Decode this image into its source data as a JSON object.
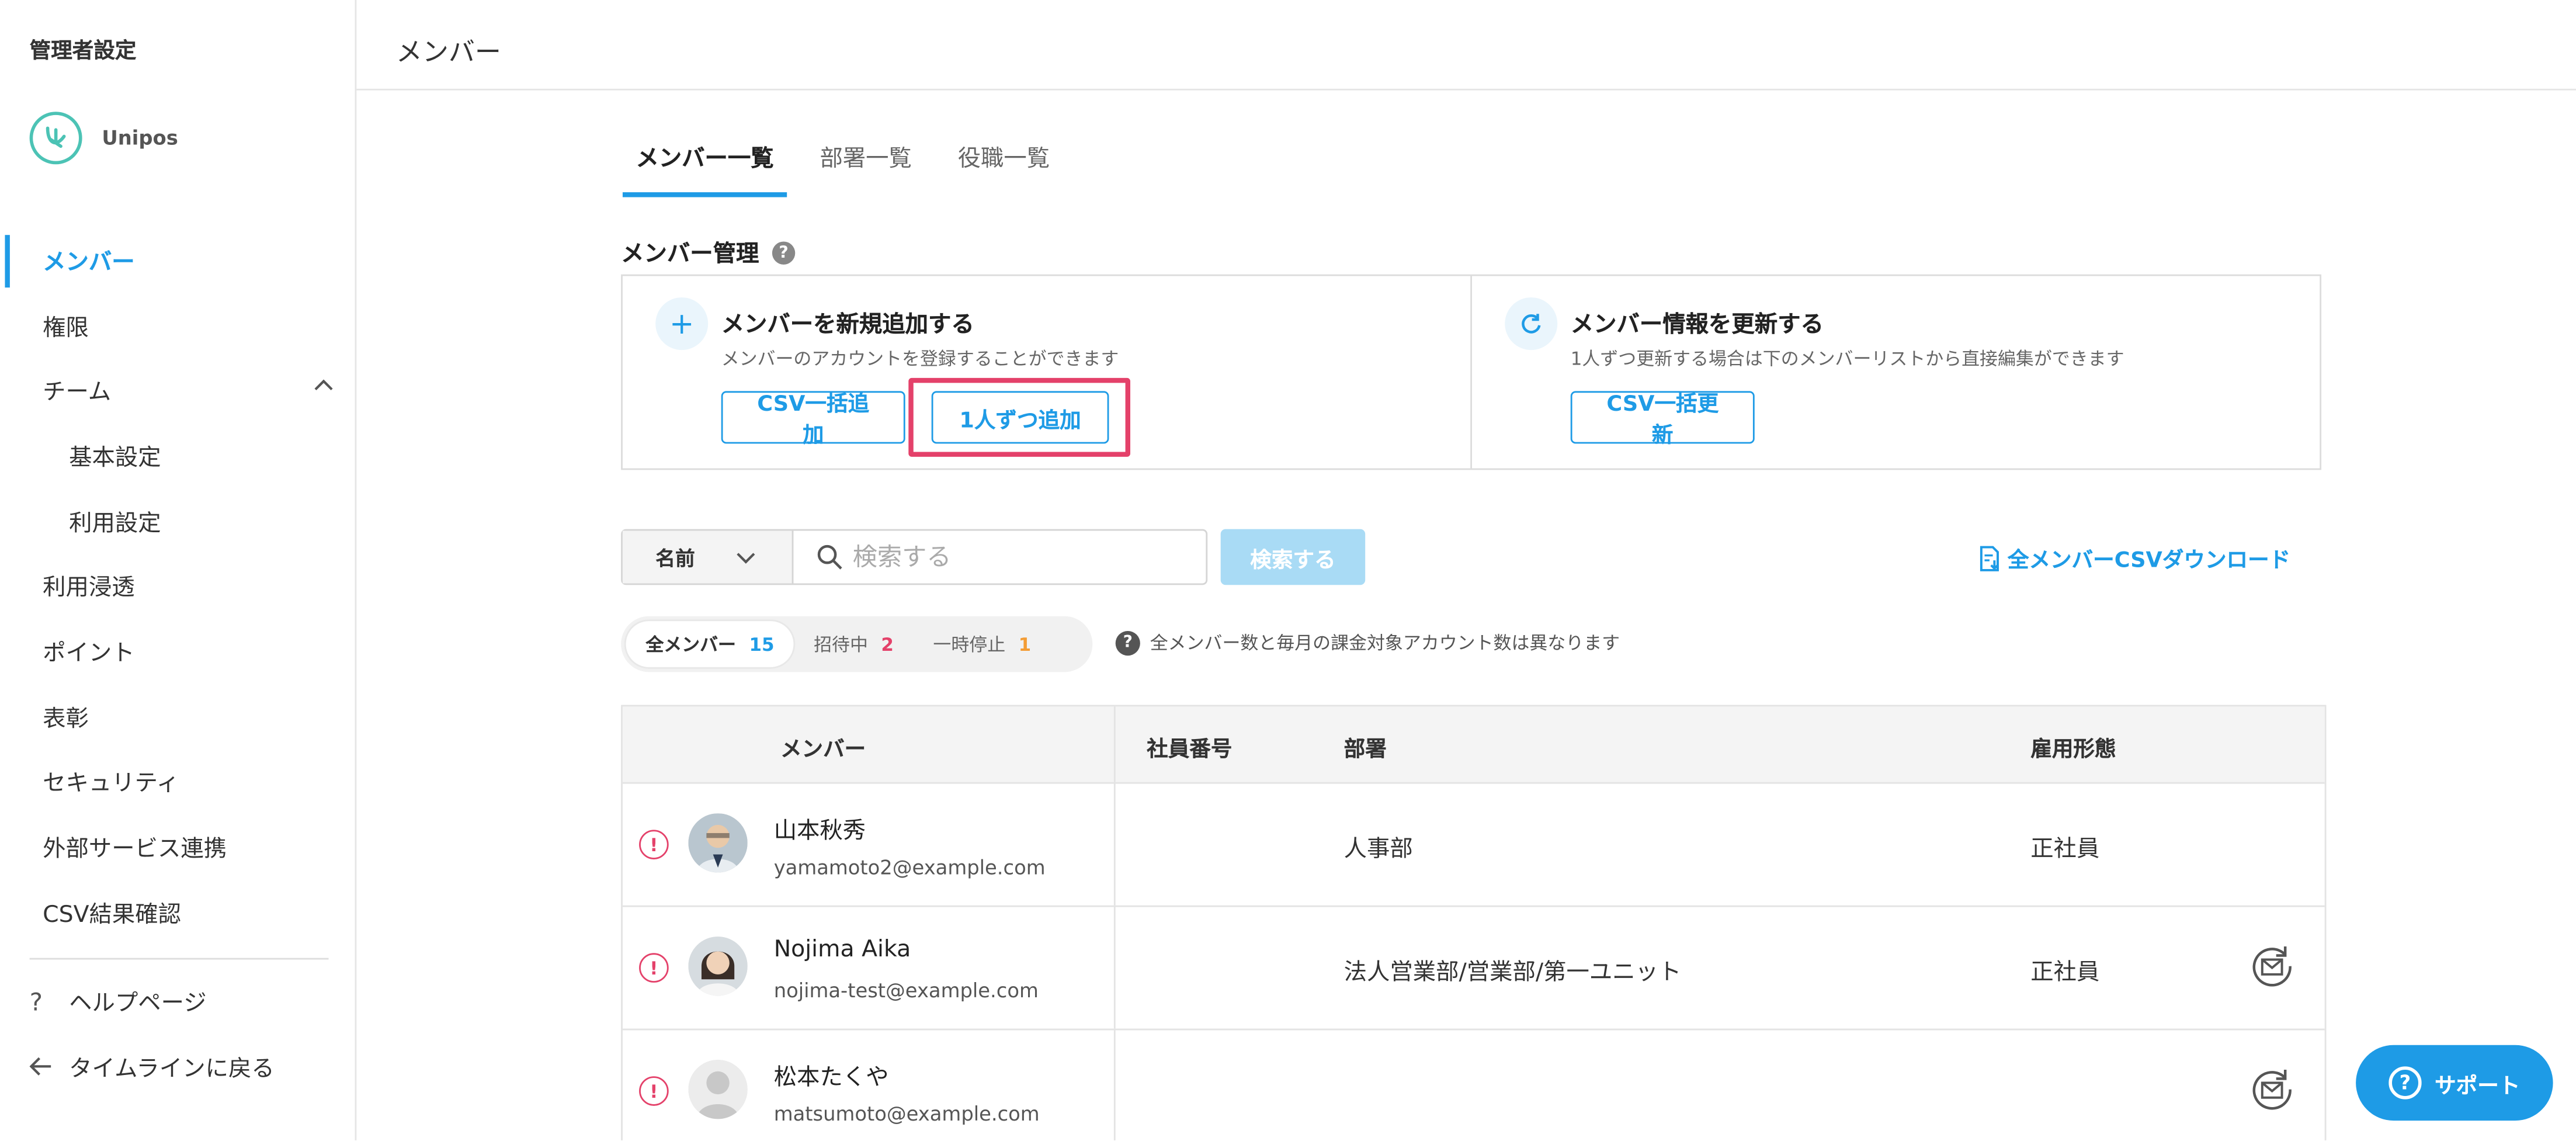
{
  "sidebar": {
    "title": "管理者設定",
    "org_name": "Unipos",
    "items": [
      {
        "label": "メンバー"
      },
      {
        "label": "権限"
      },
      {
        "label": "チーム"
      },
      {
        "label": "基本設定"
      },
      {
        "label": "利用設定"
      },
      {
        "label": "利用浸透"
      },
      {
        "label": "ポイント"
      },
      {
        "label": "表彰"
      },
      {
        "label": "セキュリティ"
      },
      {
        "label": "外部サービス連携"
      },
      {
        "label": "CSV結果確認"
      }
    ],
    "help_label": "ヘルプページ",
    "back_label": "タイムラインに戻る"
  },
  "header": {
    "title": "メンバー"
  },
  "tabs": [
    {
      "label": "メンバー一覧"
    },
    {
      "label": "部署一覧"
    },
    {
      "label": "役職一覧"
    }
  ],
  "member_mgmt": {
    "title": "メンバー管理",
    "add": {
      "title": "メンバーを新規追加する",
      "desc": "メンバーのアカウントを登録することができます",
      "csv_button": "CSV一括追加",
      "single_button": "1人ずつ追加"
    },
    "update": {
      "title": "メンバー情報を更新する",
      "desc": "1人ずつ更新する場合は下のメンバーリストから直接編集ができます",
      "csv_button": "CSV一括更新"
    }
  },
  "search": {
    "field_select": "名前",
    "placeholder": "検索する",
    "button": "検索する",
    "csv_download": "全メンバーCSVダウンロード"
  },
  "filters": {
    "pills": [
      {
        "label": "全メンバー",
        "count": "15",
        "color": "#1e9be6"
      },
      {
        "label": "招待中",
        "count": "2",
        "color": "#e4416a"
      },
      {
        "label": "一時停止",
        "count": "1",
        "color": "#f39c34"
      }
    ],
    "note": "全メンバー数と毎月の課金対象アカウント数は異なります"
  },
  "table": {
    "headers": {
      "member": "メンバー",
      "emp_no": "社員番号",
      "dept": "部署",
      "emp_type": "雇用形態"
    },
    "rows": [
      {
        "name": "山本秋秀",
        "email": "yamamoto2@example.com",
        "emp_no": "",
        "dept": "人事部",
        "emp_type": "正社員"
      },
      {
        "name": "Nojima Aika",
        "email": "nojima-test@example.com",
        "emp_no": "",
        "dept": "法人営業部/営業部/第一ユニット",
        "emp_type": "正社員"
      },
      {
        "name": "松本たくや",
        "email": "matsumoto@example.com",
        "emp_no": "",
        "dept": "",
        "emp_type": ""
      }
    ]
  },
  "support": {
    "label": "サポート"
  },
  "colors": {
    "accent": "#1e9be6",
    "highlight": "#e4416a",
    "warning": "#e4416a"
  }
}
